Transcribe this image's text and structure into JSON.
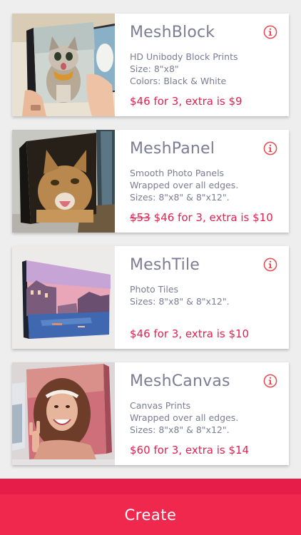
{
  "products": [
    {
      "title": "MeshBlock",
      "lines": [
        "HD Unibody Block Prints",
        "Size: 8\"x8\"",
        "Colors: Black & White"
      ],
      "old_price": "",
      "price": "$46 for 3, extra is $9",
      "image": "cat-photo-block"
    },
    {
      "title": "MeshPanel",
      "lines": [
        "Smooth Photo Panels",
        "Wrapped over all edges.",
        "Sizes: 8\"x8\" & 8\"x12\"."
      ],
      "old_price": "$53",
      "price": "$46 for 3, extra is $10",
      "image": "cat-photo-panel"
    },
    {
      "title": "MeshTile",
      "lines": [
        "Photo Tiles",
        "Sizes: 8\"x8\" & 8\"x12\"."
      ],
      "old_price": "",
      "price": "$46 for 3, extra is $10",
      "image": "venice-photo-tile"
    },
    {
      "title": "MeshCanvas",
      "lines": [
        "Canvas Prints",
        "Wrapped over all edges.",
        "Sizes: 8\"x8\" & 8\"x12\"."
      ],
      "old_price": "",
      "price": "$60 for 3, extra is $14",
      "image": "woman-photo-canvas"
    }
  ],
  "footer": {
    "create_label": "Create"
  },
  "colors": {
    "accent": "#e61e4d",
    "text": "#7a7d93",
    "footer": "#f0284e",
    "info_icon": "#e8484f"
  },
  "icons": {
    "info": "info-circle-icon"
  }
}
